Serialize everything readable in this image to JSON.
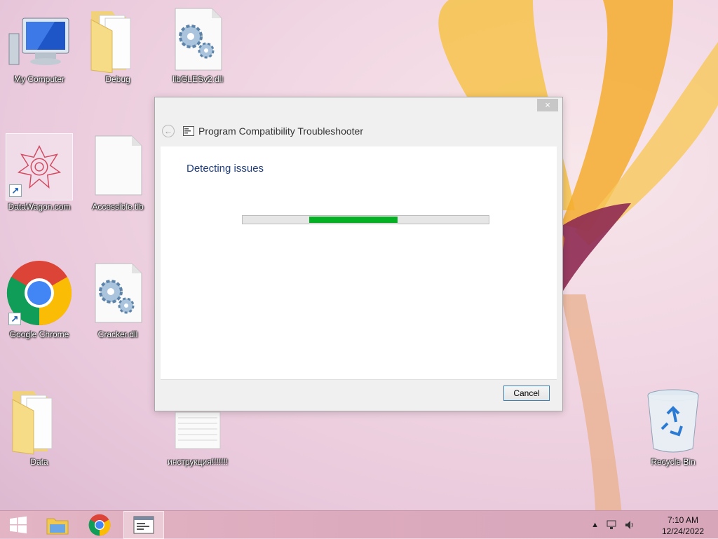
{
  "desktop": {
    "icons": [
      {
        "label": "My Computer",
        "icon": "computer-icon"
      },
      {
        "label": "Debug",
        "icon": "folder-icon"
      },
      {
        "label": "libGLESv2.dll",
        "icon": "dll-gear-icon"
      },
      {
        "label": "DataWagon.com",
        "icon": "datawagon-icon"
      },
      {
        "label": "Accessible.tlb",
        "icon": "blank-file-icon"
      },
      {
        "label": "Google Chrome",
        "icon": "chrome-icon"
      },
      {
        "label": "Cracker.dll",
        "icon": "dll-gear-icon"
      },
      {
        "label": "Data",
        "icon": "folder-icon"
      },
      {
        "label": "инструкция!!!!!!!",
        "icon": "text-file-icon"
      },
      {
        "label": "Recycle Bin",
        "icon": "recycle-bin-icon"
      }
    ]
  },
  "dialog": {
    "title": "Program Compatibility Troubleshooter",
    "close_label": "×",
    "status": "Detecting issues",
    "progress": {
      "start_fraction": 0.27,
      "end_fraction": 0.63
    },
    "cancel_label": "Cancel"
  },
  "taskbar": {
    "items": [
      {
        "icon": "windows-start-icon"
      },
      {
        "icon": "file-explorer-icon"
      },
      {
        "icon": "chrome-icon"
      },
      {
        "icon": "troubleshooter-icon",
        "active": true
      }
    ],
    "time": "7:10 AM",
    "date": "12/24/2022"
  },
  "colors": {
    "progress": "#06b025",
    "status_text": "#1e3e80"
  }
}
